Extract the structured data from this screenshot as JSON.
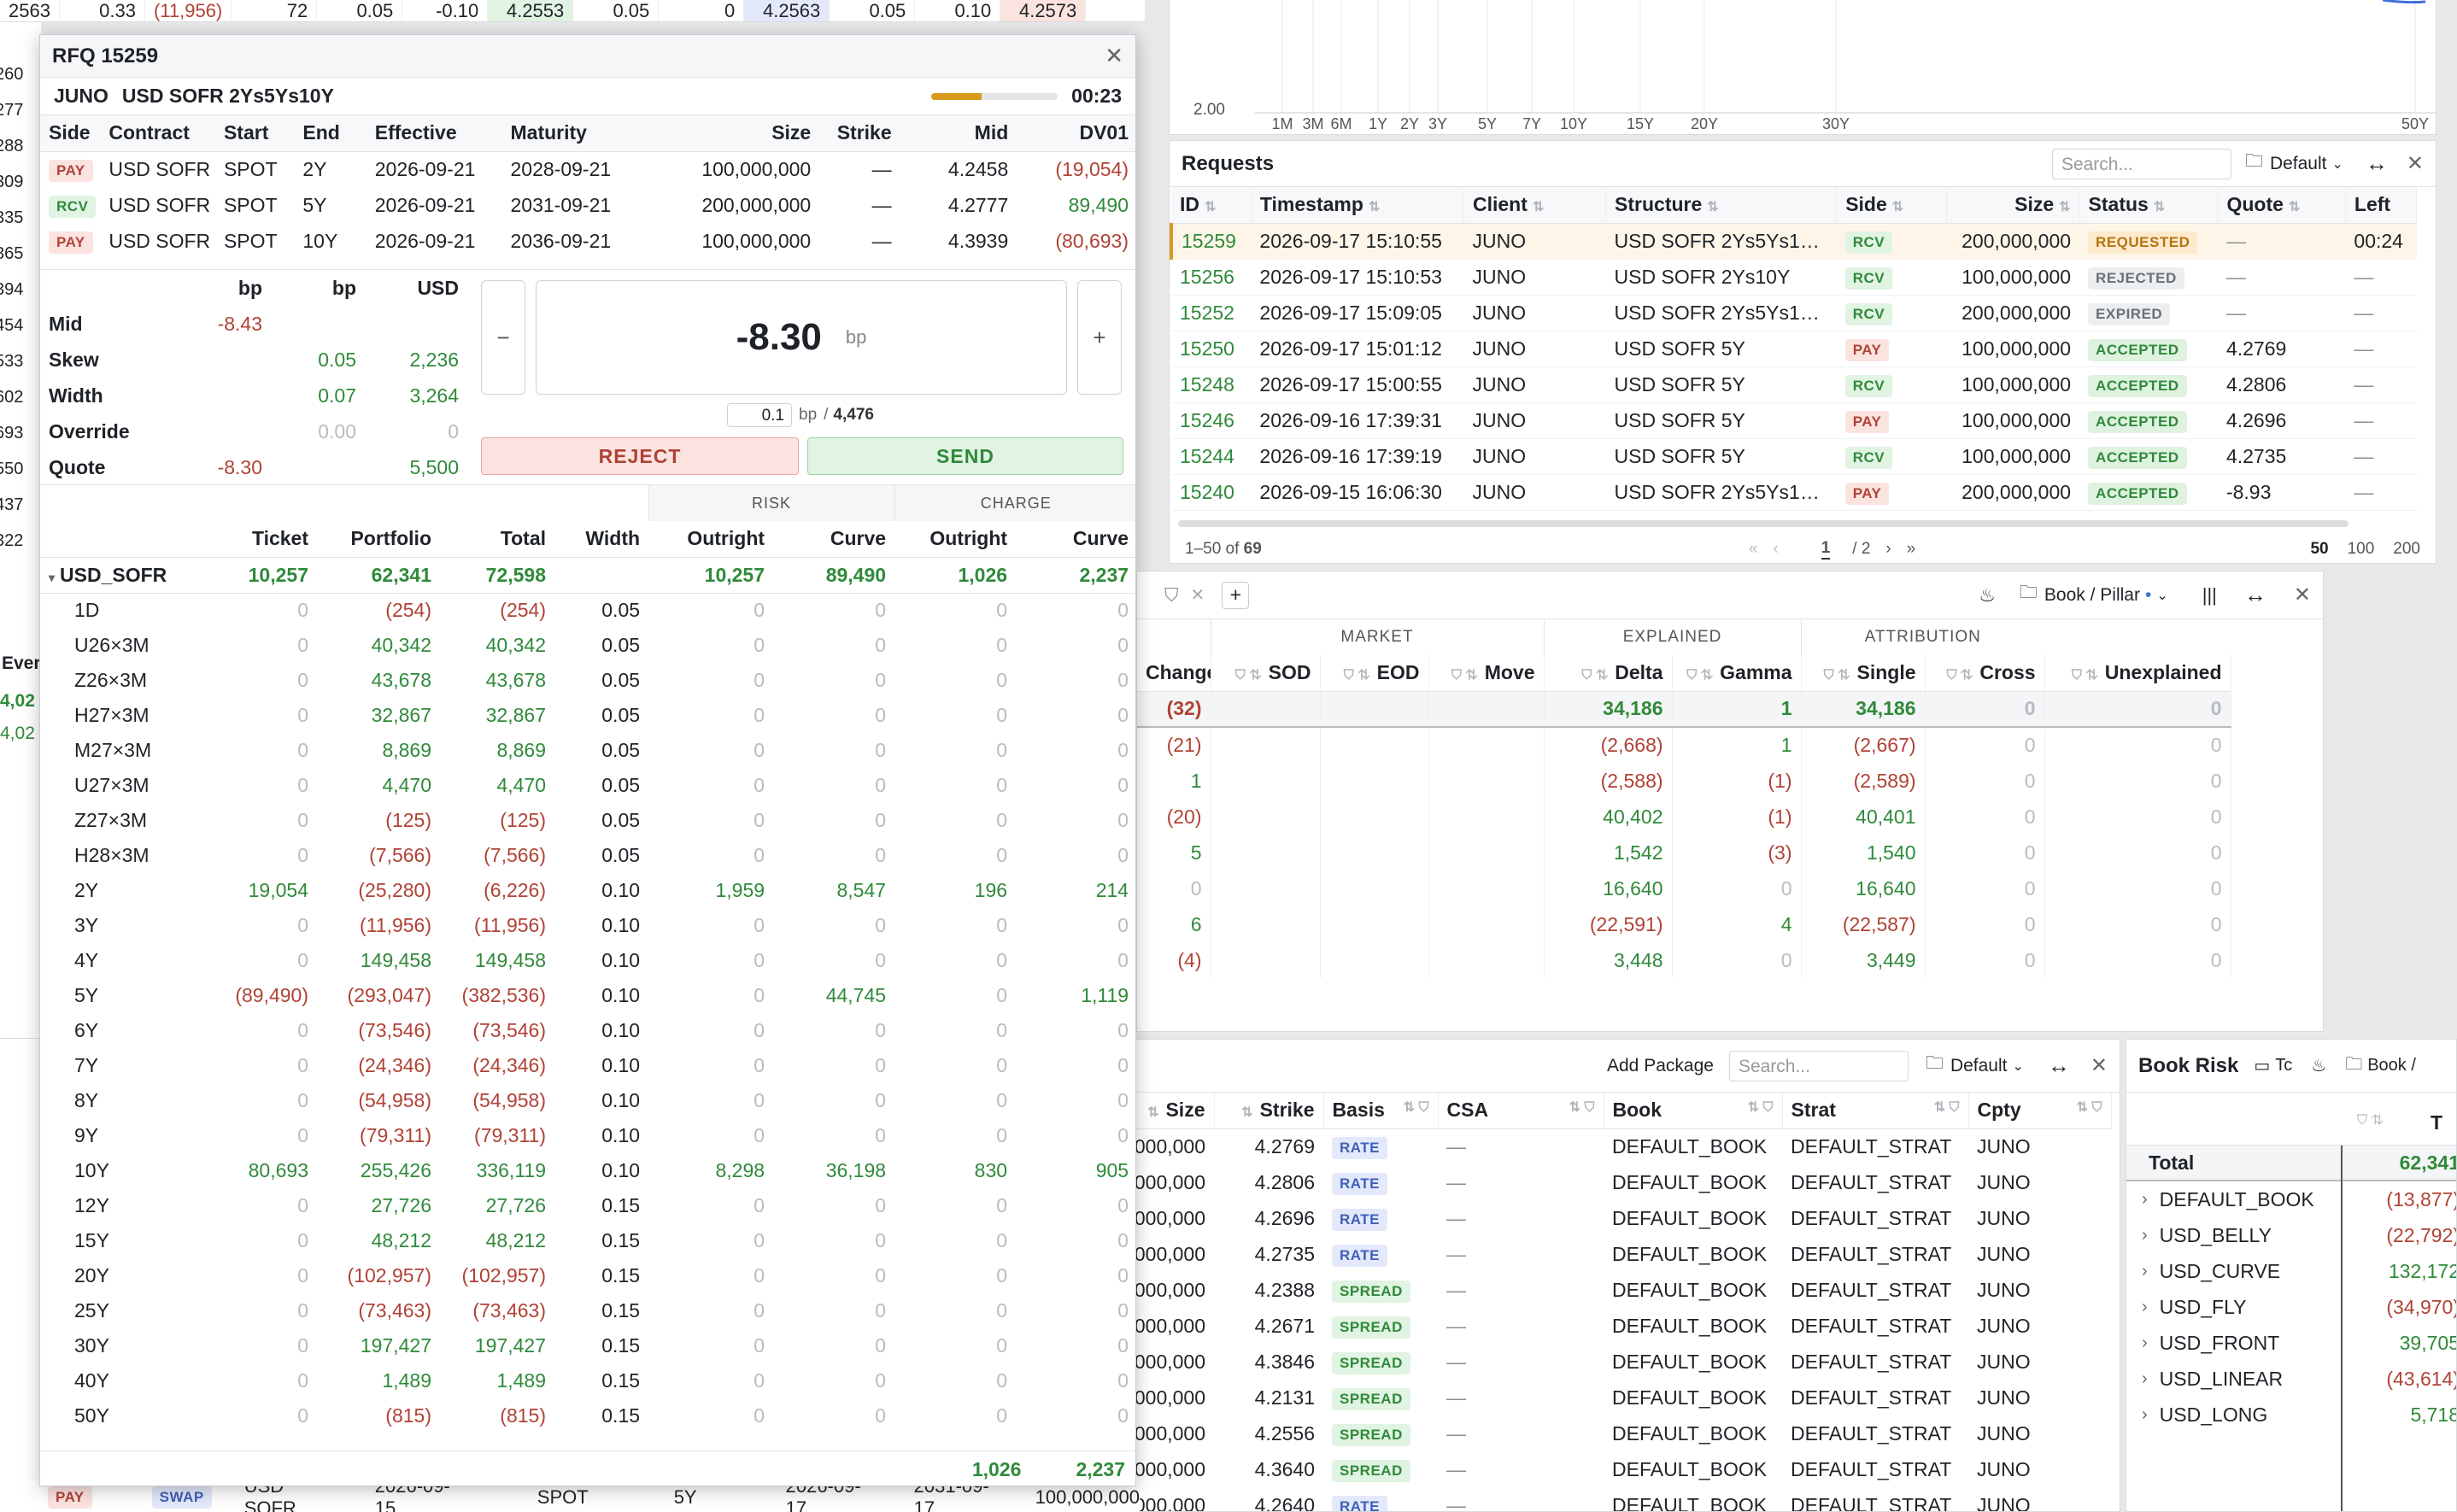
{
  "colors": {
    "pay": "#b04235",
    "rcv": "#2f8a3a",
    "accent": "#d89a1d",
    "link": "#2f8a3a"
  },
  "bg_top_left": {
    "cells": [
      "2563",
      "0.33",
      "(11,956)",
      "72",
      "0.05",
      "-0.10",
      "4.2553",
      "0.05",
      "0",
      "4.2563",
      "0.05",
      "0.10",
      "4.2573"
    ],
    "left_col": [
      "260",
      "277",
      "288",
      "309",
      "335",
      "365",
      "394",
      "454",
      "533",
      "602",
      "693",
      "550",
      "437",
      "322"
    ],
    "eve_label": "Ever",
    "eve_vals": [
      "4,02",
      "4,02"
    ]
  },
  "curve_chart": {
    "y_tick": "2.00",
    "x_ticks": [
      "1M",
      "3M",
      "6M",
      "1Y",
      "2Y",
      "3Y",
      "5Y",
      "7Y",
      "10Y",
      "15Y",
      "20Y",
      "30Y",
      "50Y"
    ]
  },
  "rfq": {
    "title": "RFQ 15259",
    "client": "JUNO",
    "structure": "USD SOFR 2Ys5Ys10Y",
    "timer": "00:23",
    "progress": 0.4,
    "legs_headers": [
      "Side",
      "Contract",
      "Start",
      "End",
      "Effective",
      "Maturity",
      "Size",
      "Strike",
      "Mid",
      "DV01"
    ],
    "legs": [
      {
        "side": "PAY",
        "contract": "USD SOFR",
        "start": "SPOT",
        "end": "2Y",
        "effective": "2026-09-21",
        "maturity": "2028-09-21",
        "size": "100,000,000",
        "strike": "—",
        "mid": "4.2458",
        "dv01": "(19,054)"
      },
      {
        "side": "RCV",
        "contract": "USD SOFR",
        "start": "SPOT",
        "end": "5Y",
        "effective": "2026-09-21",
        "maturity": "2031-09-21",
        "size": "200,000,000",
        "strike": "—",
        "mid": "4.2777",
        "dv01": "89,490"
      },
      {
        "side": "PAY",
        "contract": "USD SOFR",
        "start": "SPOT",
        "end": "10Y",
        "effective": "2026-09-21",
        "maturity": "2036-09-21",
        "size": "100,000,000",
        "strike": "—",
        "mid": "4.3939",
        "dv01": "(80,693)"
      }
    ],
    "pricing_units": [
      "bp",
      "bp",
      "USD"
    ],
    "pricing": [
      {
        "label": "Mid",
        "c1": "-8.43",
        "c2": "",
        "c3": ""
      },
      {
        "label": "Skew",
        "c1": "",
        "c2": "0.05",
        "c3": "2,236"
      },
      {
        "label": "Width",
        "c1": "",
        "c2": "0.07",
        "c3": "3,264"
      },
      {
        "label": "Override",
        "c1": "",
        "c2": "0.00",
        "c3": "0"
      },
      {
        "label": "Quote",
        "c1": "-8.30",
        "c2": "",
        "c3": "5,500"
      }
    ],
    "quote_value": "-8.30",
    "quote_unit": "bp",
    "minus": "−",
    "plus": "+",
    "step": "0.1",
    "step_unit": "bp",
    "step_sep": "/",
    "step_usd": "4,476",
    "reject": "REJECT",
    "send": "SEND",
    "risk_group": "RISK",
    "charge_group": "CHARGE",
    "risk_headers": [
      "",
      "Ticket",
      "Portfolio",
      "Total",
      "Width",
      "Outright",
      "Curve",
      "Outright",
      "Curve"
    ],
    "risk_total": {
      "name": "USD_SOFR",
      "ticket": "10,257",
      "portfolio": "62,341",
      "total": "72,598",
      "width": "",
      "ro": "10,257",
      "rc": "89,490",
      "co": "1,026",
      "cc": "2,237"
    },
    "risk_rows": [
      [
        "1D",
        "0",
        "(254)",
        "(254)",
        "0.05",
        "0",
        "0",
        "0",
        "0"
      ],
      [
        "U26×3M",
        "0",
        "40,342",
        "40,342",
        "0.05",
        "0",
        "0",
        "0",
        "0"
      ],
      [
        "Z26×3M",
        "0",
        "43,678",
        "43,678",
        "0.05",
        "0",
        "0",
        "0",
        "0"
      ],
      [
        "H27×3M",
        "0",
        "32,867",
        "32,867",
        "0.05",
        "0",
        "0",
        "0",
        "0"
      ],
      [
        "M27×3M",
        "0",
        "8,869",
        "8,869",
        "0.05",
        "0",
        "0",
        "0",
        "0"
      ],
      [
        "U27×3M",
        "0",
        "4,470",
        "4,470",
        "0.05",
        "0",
        "0",
        "0",
        "0"
      ],
      [
        "Z27×3M",
        "0",
        "(125)",
        "(125)",
        "0.05",
        "0",
        "0",
        "0",
        "0"
      ],
      [
        "H28×3M",
        "0",
        "(7,566)",
        "(7,566)",
        "0.05",
        "0",
        "0",
        "0",
        "0"
      ],
      [
        "2Y",
        "19,054",
        "(25,280)",
        "(6,226)",
        "0.10",
        "1,959",
        "8,547",
        "196",
        "214"
      ],
      [
        "3Y",
        "0",
        "(11,956)",
        "(11,956)",
        "0.10",
        "0",
        "0",
        "0",
        "0"
      ],
      [
        "4Y",
        "0",
        "149,458",
        "149,458",
        "0.10",
        "0",
        "0",
        "0",
        "0"
      ],
      [
        "5Y",
        "(89,490)",
        "(293,047)",
        "(382,536)",
        "0.10",
        "0",
        "44,745",
        "0",
        "1,119"
      ],
      [
        "6Y",
        "0",
        "(73,546)",
        "(73,546)",
        "0.10",
        "0",
        "0",
        "0",
        "0"
      ],
      [
        "7Y",
        "0",
        "(24,346)",
        "(24,346)",
        "0.10",
        "0",
        "0",
        "0",
        "0"
      ],
      [
        "8Y",
        "0",
        "(54,958)",
        "(54,958)",
        "0.10",
        "0",
        "0",
        "0",
        "0"
      ],
      [
        "9Y",
        "0",
        "(79,311)",
        "(79,311)",
        "0.10",
        "0",
        "0",
        "0",
        "0"
      ],
      [
        "10Y",
        "80,693",
        "255,426",
        "336,119",
        "0.10",
        "8,298",
        "36,198",
        "830",
        "905"
      ],
      [
        "12Y",
        "0",
        "27,726",
        "27,726",
        "0.15",
        "0",
        "0",
        "0",
        "0"
      ],
      [
        "15Y",
        "0",
        "48,212",
        "48,212",
        "0.15",
        "0",
        "0",
        "0",
        "0"
      ],
      [
        "20Y",
        "0",
        "(102,957)",
        "(102,957)",
        "0.15",
        "0",
        "0",
        "0",
        "0"
      ],
      [
        "25Y",
        "0",
        "(73,463)",
        "(73,463)",
        "0.15",
        "0",
        "0",
        "0",
        "0"
      ],
      [
        "30Y",
        "0",
        "197,427",
        "197,427",
        "0.15",
        "0",
        "0",
        "0",
        "0"
      ],
      [
        "40Y",
        "0",
        "1,489",
        "1,489",
        "0.15",
        "0",
        "0",
        "0",
        "0"
      ],
      [
        "50Y",
        "0",
        "(815)",
        "(815)",
        "0.15",
        "0",
        "0",
        "0",
        "0"
      ]
    ],
    "footer": {
      "co": "1,026",
      "cc": "2,237"
    }
  },
  "requests": {
    "title": "Requests",
    "search_placeholder": "Search...",
    "view": "Default",
    "headers": [
      "ID",
      "Timestamp",
      "Client",
      "Structure",
      "Side",
      "Size",
      "Status",
      "Quote",
      "Left"
    ],
    "rows": [
      {
        "id": "15259",
        "ts": "2026-09-17 15:10:55",
        "client": "JUNO",
        "structure": "USD SOFR 2Ys5Ys1…",
        "side": "RCV",
        "size": "200,000,000",
        "status": "REQUESTED",
        "quote": "—",
        "left": "00:24"
      },
      {
        "id": "15256",
        "ts": "2026-09-17 15:10:53",
        "client": "JUNO",
        "structure": "USD SOFR 2Ys10Y",
        "side": "RCV",
        "size": "100,000,000",
        "status": "REJECTED",
        "quote": "—",
        "left": "—"
      },
      {
        "id": "15252",
        "ts": "2026-09-17 15:09:05",
        "client": "JUNO",
        "structure": "USD SOFR 2Ys5Ys1…",
        "side": "RCV",
        "size": "200,000,000",
        "status": "EXPIRED",
        "quote": "—",
        "left": "—"
      },
      {
        "id": "15250",
        "ts": "2026-09-17 15:01:12",
        "client": "JUNO",
        "structure": "USD SOFR 5Y",
        "side": "PAY",
        "size": "100,000,000",
        "status": "ACCEPTED",
        "quote": "4.2769",
        "left": "—"
      },
      {
        "id": "15248",
        "ts": "2026-09-17 15:00:55",
        "client": "JUNO",
        "structure": "USD SOFR 5Y",
        "side": "RCV",
        "size": "100,000,000",
        "status": "ACCEPTED",
        "quote": "4.2806",
        "left": "—"
      },
      {
        "id": "15246",
        "ts": "2026-09-16 17:39:31",
        "client": "JUNO",
        "structure": "USD SOFR 5Y",
        "side": "PAY",
        "size": "100,000,000",
        "status": "ACCEPTED",
        "quote": "4.2696",
        "left": "—"
      },
      {
        "id": "15244",
        "ts": "2026-09-16 17:39:19",
        "client": "JUNO",
        "structure": "USD SOFR 5Y",
        "side": "RCV",
        "size": "100,000,000",
        "status": "ACCEPTED",
        "quote": "4.2735",
        "left": "—"
      },
      {
        "id": "15240",
        "ts": "2026-09-15 16:06:30",
        "client": "JUNO",
        "structure": "USD SOFR 2Ys5Ys1…",
        "side": "PAY",
        "size": "200,000,000",
        "status": "ACCEPTED",
        "quote": "-8.93",
        "left": "—"
      }
    ],
    "pager": {
      "range": "1–50 of ",
      "total": "69",
      "first": "«",
      "prev": "‹",
      "page": "1",
      "of": "/ 2",
      "next": "›",
      "last": "»",
      "sizes": [
        "50",
        "100",
        "200"
      ]
    }
  },
  "pnl": {
    "view": "Book / Pillar",
    "view_dot": "•",
    "groups": [
      "MARKET",
      "EXPLAINED",
      "ATTRIBUTION"
    ],
    "headers": [
      "Change",
      "SOD",
      "EOD",
      "Move",
      "Delta",
      "Gamma",
      "Single",
      "Cross",
      "Unexplained"
    ],
    "total": [
      "(32)",
      "",
      "",
      "",
      "34,186",
      "1",
      "34,186",
      "0",
      "0"
    ],
    "rows": [
      [
        "(21)",
        "",
        "",
        "",
        "(2,668)",
        "1",
        "(2,667)",
        "0",
        "0"
      ],
      [
        "1",
        "",
        "",
        "",
        "(2,588)",
        "(1)",
        "(2,589)",
        "0",
        "0"
      ],
      [
        "(20)",
        "",
        "",
        "",
        "40,402",
        "(1)",
        "40,401",
        "0",
        "0"
      ],
      [
        "5",
        "",
        "",
        "",
        "1,542",
        "(3)",
        "1,540",
        "0",
        "0"
      ],
      [
        "0",
        "",
        "",
        "",
        "16,640",
        "0",
        "16,640",
        "0",
        "0"
      ],
      [
        "6",
        "",
        "",
        "",
        "(22,591)",
        "4",
        "(22,587)",
        "0",
        "0"
      ],
      [
        "(4)",
        "",
        "",
        "",
        "3,448",
        "0",
        "3,449",
        "0",
        "0"
      ]
    ]
  },
  "trades": {
    "add_package": "Add Package",
    "search_placeholder": "Search...",
    "view": "Default",
    "headers": [
      "Size",
      "Strike",
      "Basis",
      "CSA",
      "Book",
      "Strat",
      "Cpty"
    ],
    "rows": [
      [
        "000,000",
        "4.2769",
        "RATE",
        "—",
        "DEFAULT_BOOK",
        "DEFAULT_STRAT",
        "JUNO"
      ],
      [
        "000,000",
        "4.2806",
        "RATE",
        "—",
        "DEFAULT_BOOK",
        "DEFAULT_STRAT",
        "JUNO"
      ],
      [
        "000,000",
        "4.2696",
        "RATE",
        "—",
        "DEFAULT_BOOK",
        "DEFAULT_STRAT",
        "JUNO"
      ],
      [
        "000,000",
        "4.2735",
        "RATE",
        "—",
        "DEFAULT_BOOK",
        "DEFAULT_STRAT",
        "JUNO"
      ],
      [
        "000,000",
        "4.2388",
        "SPREAD",
        "—",
        "DEFAULT_BOOK",
        "DEFAULT_STRAT",
        "JUNO"
      ],
      [
        "000,000",
        "4.2671",
        "SPREAD",
        "—",
        "DEFAULT_BOOK",
        "DEFAULT_STRAT",
        "JUNO"
      ],
      [
        "000,000",
        "4.3846",
        "SPREAD",
        "—",
        "DEFAULT_BOOK",
        "DEFAULT_STRAT",
        "JUNO"
      ],
      [
        "000,000",
        "4.2131",
        "SPREAD",
        "—",
        "DEFAULT_BOOK",
        "DEFAULT_STRAT",
        "JUNO"
      ],
      [
        "000,000",
        "4.2556",
        "SPREAD",
        "—",
        "DEFAULT_BOOK",
        "DEFAULT_STRAT",
        "JUNO"
      ],
      [
        "000,000",
        "4.3640",
        "SPREAD",
        "—",
        "DEFAULT_BOOK",
        "DEFAULT_STRAT",
        "JUNO"
      ],
      [
        "000,000",
        "4.2640",
        "RATE",
        "—",
        "DEFAULT_BOOK",
        "DEFAULT_STRAT",
        "JUNO"
      ]
    ],
    "bottom_row": {
      "side": "PAY",
      "type": "SWAP",
      "contract": "USD SOFR",
      "date": "2026-09-15",
      "start": "SPOT",
      "end": "5Y",
      "eff": "2026-09-17",
      "mat": "2031-09-17",
      "size": "100,000,000"
    }
  },
  "book_risk": {
    "title": "Book Risk",
    "tab1": "Tc",
    "tab2": "Book /",
    "col": "T",
    "total_label": "Total",
    "total_val": "62,341",
    "rows": [
      {
        "name": "DEFAULT_BOOK",
        "val": "(13,877)"
      },
      {
        "name": "USD_BELLY",
        "val": "(22,792)"
      },
      {
        "name": "USD_CURVE",
        "val": "132,172"
      },
      {
        "name": "USD_FLY",
        "val": "(34,970)"
      },
      {
        "name": "USD_FRONT",
        "val": "39,705"
      },
      {
        "name": "USD_LINEAR",
        "val": "(43,614)"
      },
      {
        "name": "USD_LONG",
        "val": "5,718"
      }
    ]
  }
}
